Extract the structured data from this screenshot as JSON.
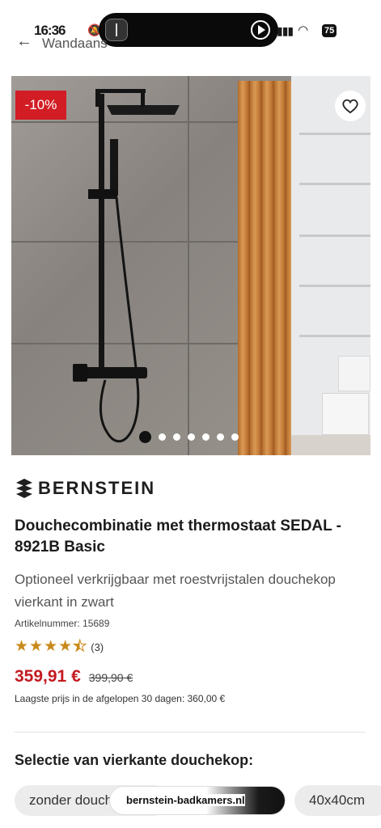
{
  "status_bar": {
    "time": "16:36",
    "battery": "75"
  },
  "nav": {
    "breadcrumb": "Wandaans"
  },
  "gallery": {
    "discount_badge": "-10%",
    "image_count": 7,
    "active_index": 0
  },
  "product": {
    "brand": "BERNSTEIN",
    "title": "Douchecombinatie met thermostaat SEDAL - 8921B Basic",
    "subtitle": "Optioneel verkrijgbaar met roestvrijstalen douchekop vierkant in zwart",
    "article_number": "Artikelnummer: 15689",
    "rating": 4.5,
    "rating_count": "(3)",
    "price_current": "359,91 €",
    "price_old": "399,90 €",
    "lowest_price_note": "Laagste prijs in de afgelopen 30 dagen: 360,00 €"
  },
  "selection": {
    "title": "Selectie van vierkante douchekop:",
    "options": [
      "zonder douchekop",
      "40x40cm"
    ]
  },
  "browser": {
    "url": "bernstein-badkamers.nl"
  },
  "colors": {
    "discount": "#d21d24",
    "price": "#c41a21",
    "stars": "#c98a1c"
  }
}
